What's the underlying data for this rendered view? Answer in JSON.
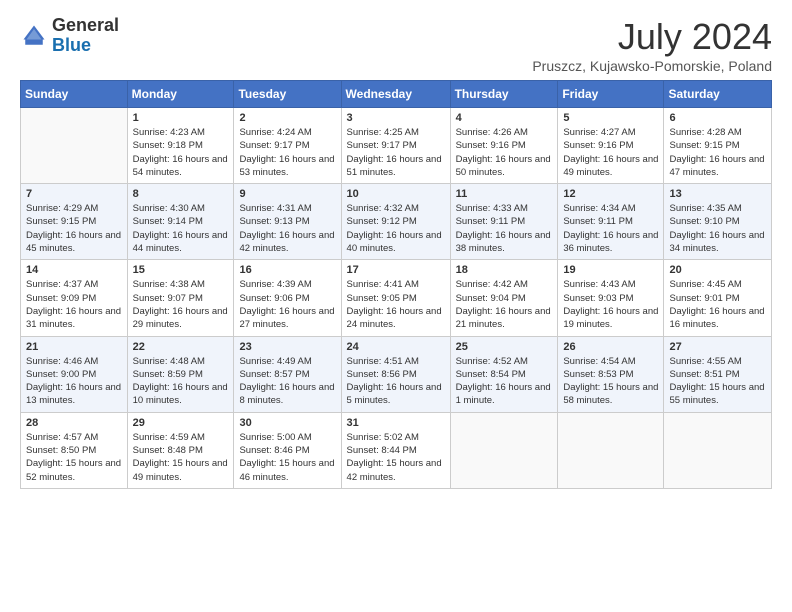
{
  "header": {
    "logo_line1": "General",
    "logo_line2": "Blue",
    "month_title": "July 2024",
    "location": "Pruszcz, Kujawsko-Pomorskie, Poland"
  },
  "days_of_week": [
    "Sunday",
    "Monday",
    "Tuesday",
    "Wednesday",
    "Thursday",
    "Friday",
    "Saturday"
  ],
  "weeks": [
    [
      {
        "day": "",
        "info": ""
      },
      {
        "day": "1",
        "info": "Sunrise: 4:23 AM\nSunset: 9:18 PM\nDaylight: 16 hours\nand 54 minutes."
      },
      {
        "day": "2",
        "info": "Sunrise: 4:24 AM\nSunset: 9:17 PM\nDaylight: 16 hours\nand 53 minutes."
      },
      {
        "day": "3",
        "info": "Sunrise: 4:25 AM\nSunset: 9:17 PM\nDaylight: 16 hours\nand 51 minutes."
      },
      {
        "day": "4",
        "info": "Sunrise: 4:26 AM\nSunset: 9:16 PM\nDaylight: 16 hours\nand 50 minutes."
      },
      {
        "day": "5",
        "info": "Sunrise: 4:27 AM\nSunset: 9:16 PM\nDaylight: 16 hours\nand 49 minutes."
      },
      {
        "day": "6",
        "info": "Sunrise: 4:28 AM\nSunset: 9:15 PM\nDaylight: 16 hours\nand 47 minutes."
      }
    ],
    [
      {
        "day": "7",
        "info": "Sunrise: 4:29 AM\nSunset: 9:15 PM\nDaylight: 16 hours\nand 45 minutes."
      },
      {
        "day": "8",
        "info": "Sunrise: 4:30 AM\nSunset: 9:14 PM\nDaylight: 16 hours\nand 44 minutes."
      },
      {
        "day": "9",
        "info": "Sunrise: 4:31 AM\nSunset: 9:13 PM\nDaylight: 16 hours\nand 42 minutes."
      },
      {
        "day": "10",
        "info": "Sunrise: 4:32 AM\nSunset: 9:12 PM\nDaylight: 16 hours\nand 40 minutes."
      },
      {
        "day": "11",
        "info": "Sunrise: 4:33 AM\nSunset: 9:11 PM\nDaylight: 16 hours\nand 38 minutes."
      },
      {
        "day": "12",
        "info": "Sunrise: 4:34 AM\nSunset: 9:11 PM\nDaylight: 16 hours\nand 36 minutes."
      },
      {
        "day": "13",
        "info": "Sunrise: 4:35 AM\nSunset: 9:10 PM\nDaylight: 16 hours\nand 34 minutes."
      }
    ],
    [
      {
        "day": "14",
        "info": "Sunrise: 4:37 AM\nSunset: 9:09 PM\nDaylight: 16 hours\nand 31 minutes."
      },
      {
        "day": "15",
        "info": "Sunrise: 4:38 AM\nSunset: 9:07 PM\nDaylight: 16 hours\nand 29 minutes."
      },
      {
        "day": "16",
        "info": "Sunrise: 4:39 AM\nSunset: 9:06 PM\nDaylight: 16 hours\nand 27 minutes."
      },
      {
        "day": "17",
        "info": "Sunrise: 4:41 AM\nSunset: 9:05 PM\nDaylight: 16 hours\nand 24 minutes."
      },
      {
        "day": "18",
        "info": "Sunrise: 4:42 AM\nSunset: 9:04 PM\nDaylight: 16 hours\nand 21 minutes."
      },
      {
        "day": "19",
        "info": "Sunrise: 4:43 AM\nSunset: 9:03 PM\nDaylight: 16 hours\nand 19 minutes."
      },
      {
        "day": "20",
        "info": "Sunrise: 4:45 AM\nSunset: 9:01 PM\nDaylight: 16 hours\nand 16 minutes."
      }
    ],
    [
      {
        "day": "21",
        "info": "Sunrise: 4:46 AM\nSunset: 9:00 PM\nDaylight: 16 hours\nand 13 minutes."
      },
      {
        "day": "22",
        "info": "Sunrise: 4:48 AM\nSunset: 8:59 PM\nDaylight: 16 hours\nand 10 minutes."
      },
      {
        "day": "23",
        "info": "Sunrise: 4:49 AM\nSunset: 8:57 PM\nDaylight: 16 hours\nand 8 minutes."
      },
      {
        "day": "24",
        "info": "Sunrise: 4:51 AM\nSunset: 8:56 PM\nDaylight: 16 hours\nand 5 minutes."
      },
      {
        "day": "25",
        "info": "Sunrise: 4:52 AM\nSunset: 8:54 PM\nDaylight: 16 hours\nand 1 minute."
      },
      {
        "day": "26",
        "info": "Sunrise: 4:54 AM\nSunset: 8:53 PM\nDaylight: 15 hours\nand 58 minutes."
      },
      {
        "day": "27",
        "info": "Sunrise: 4:55 AM\nSunset: 8:51 PM\nDaylight: 15 hours\nand 55 minutes."
      }
    ],
    [
      {
        "day": "28",
        "info": "Sunrise: 4:57 AM\nSunset: 8:50 PM\nDaylight: 15 hours\nand 52 minutes."
      },
      {
        "day": "29",
        "info": "Sunrise: 4:59 AM\nSunset: 8:48 PM\nDaylight: 15 hours\nand 49 minutes."
      },
      {
        "day": "30",
        "info": "Sunrise: 5:00 AM\nSunset: 8:46 PM\nDaylight: 15 hours\nand 46 minutes."
      },
      {
        "day": "31",
        "info": "Sunrise: 5:02 AM\nSunset: 8:44 PM\nDaylight: 15 hours\nand 42 minutes."
      },
      {
        "day": "",
        "info": ""
      },
      {
        "day": "",
        "info": ""
      },
      {
        "day": "",
        "info": ""
      }
    ]
  ]
}
